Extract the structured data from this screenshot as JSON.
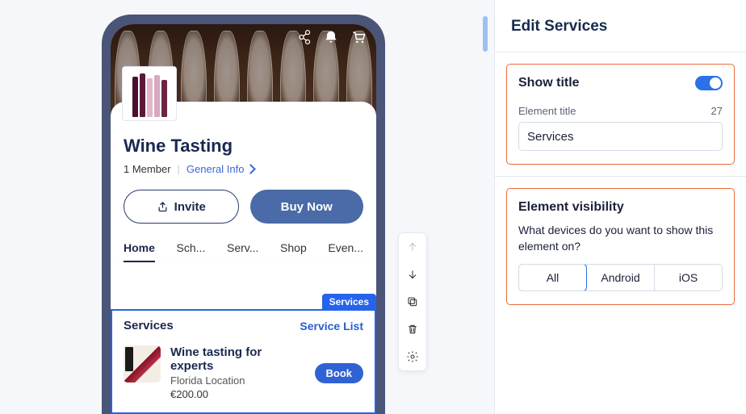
{
  "panel": {
    "title": "Edit Services",
    "showTitle": {
      "label": "Show title",
      "fieldLabel": "Element title",
      "charCount": "27",
      "value": "Services"
    },
    "visibility": {
      "label": "Element visibility",
      "question": "What devices do you want to show this element on?",
      "options": [
        "All",
        "Android",
        "iOS"
      ],
      "active": "All"
    }
  },
  "preview": {
    "group": {
      "title": "Wine Tasting",
      "members": "1 Member",
      "infoLink": "General Info",
      "inviteLabel": "Invite",
      "buyLabel": "Buy Now"
    },
    "tabs": [
      "Home",
      "Sch...",
      "Serv...",
      "Shop",
      "Even..."
    ],
    "activeTab": "Home",
    "servicesBadge": "Services",
    "services": {
      "sectionTitle": "Services",
      "listLink": "Service List",
      "items": [
        {
          "name": "Wine tasting for experts",
          "location": "Florida Location",
          "price": "€200.00",
          "bookLabel": "Book"
        }
      ]
    }
  }
}
